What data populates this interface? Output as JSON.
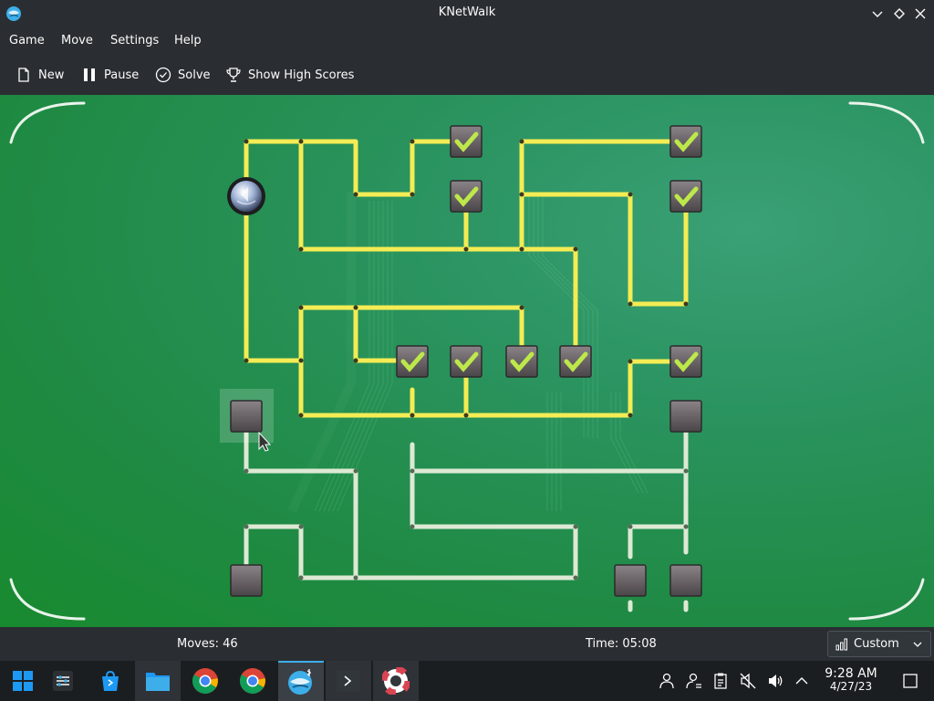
{
  "window": {
    "title": "KNetWalk"
  },
  "menu": [
    "Game",
    "Move",
    "Settings",
    "Help"
  ],
  "toolbar": {
    "new_label": "New",
    "pause_label": "Pause",
    "solve_label": "Solve",
    "highscores_label": "Show High Scores"
  },
  "status": {
    "moves": "Moves: 46",
    "time": "Time: 05:08",
    "difficulty": "Custom"
  },
  "taskbar": {
    "time": "9:28 AM",
    "date": "4/27/23",
    "apps": [
      "application-launcher-icon",
      "system-settings-icon",
      "discover-icon",
      "file-manager-icon",
      "chrome-icon",
      "chrome-icon",
      "knetwalk-icon",
      "konsole-icon",
      "help-icon"
    ]
  },
  "colors": {
    "connected_cable": "#f4ec54",
    "disconnected_cable": "#dde9d4",
    "board_green": "#2b9461",
    "accent": "#3daee9"
  },
  "game": {
    "connected_terminals": 10,
    "disconnected_terminals": 5,
    "server": 1
  }
}
